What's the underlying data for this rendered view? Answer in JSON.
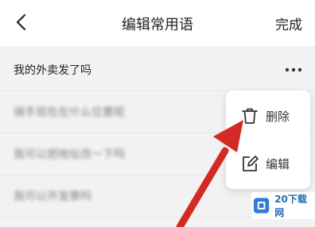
{
  "header": {
    "title": "编辑常用语",
    "done_label": "完成",
    "back_icon": "chevron-left-icon"
  },
  "list": {
    "items": [
      {
        "text": "我的外卖发了吗"
      },
      {
        "text": "骑手现在在什么位置呢"
      },
      {
        "text": "我可以把地址改一下吗"
      },
      {
        "text": "我可以开发票吗"
      }
    ],
    "more_icon": "more-horizontal-icon"
  },
  "popup": {
    "delete_label": "删除",
    "edit_label": "编辑",
    "delete_icon": "trash-icon",
    "edit_icon": "edit-icon"
  },
  "overlay": {
    "arrow_color": "#d42a25"
  },
  "watermark": {
    "text": "20下载网"
  }
}
